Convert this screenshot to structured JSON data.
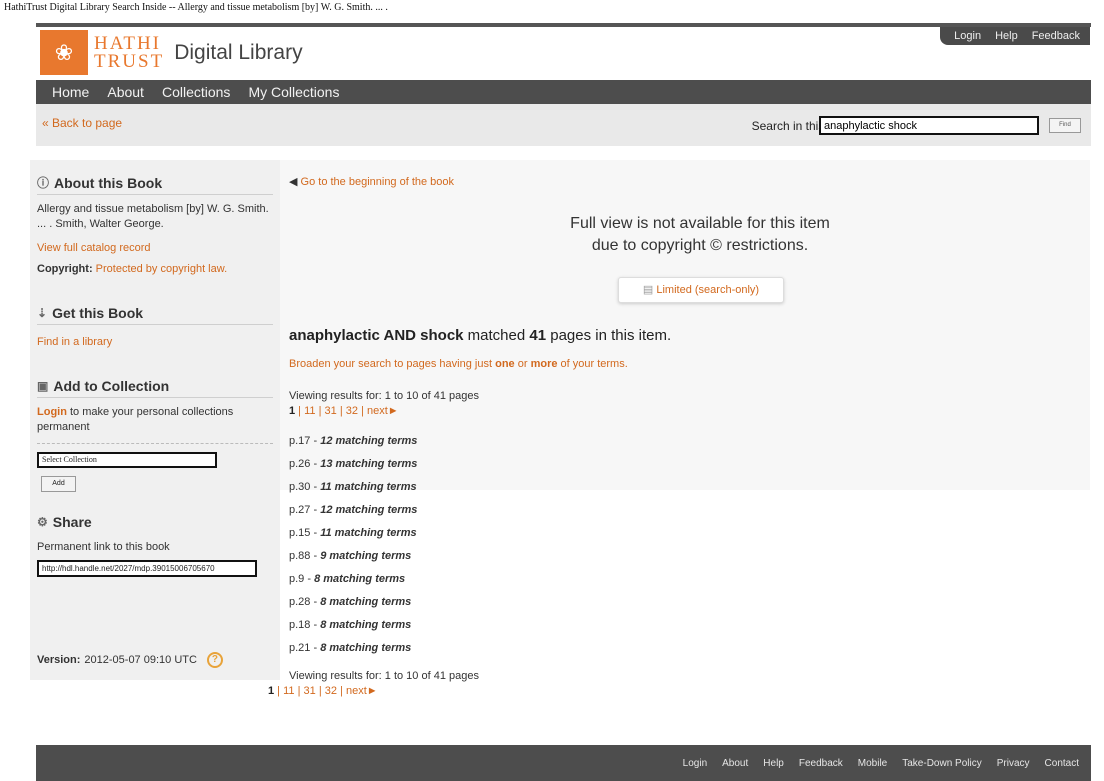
{
  "document_title": "HathiTrust Digital Library Search Inside -- Allergy and tissue metabolism [by] W. G. Smith. ... .",
  "util_nav": [
    "Login",
    "Help",
    "Feedback"
  ],
  "logo": {
    "line1": "HATHI",
    "line2": "TRUST",
    "tagline": "Digital Library"
  },
  "main_nav": [
    "Home",
    "About",
    "Collections",
    "My Collections"
  ],
  "subbar": {
    "back_label": "« Back to page",
    "search_label": "Search in this text",
    "search_value": "anaphylactic shock",
    "find_label": "Find"
  },
  "sidebar": {
    "about_heading": "About this Book",
    "book_title": "Allergy and tissue metabolism [by] W. G. Smith. ... . Smith, Walter George.",
    "catalog_link": "View full catalog record",
    "copyright_label": "Copyright:",
    "copyright_value": "Protected by copyright law.",
    "get_heading": "Get this Book",
    "find_library": "Find in a library",
    "add_heading": "Add to Collection",
    "login_link": "Login",
    "login_text": "to make your personal collections permanent",
    "select_value": "Select Collection",
    "add_button": "Add",
    "share_heading": "Share",
    "permalink_label": "Permanent link to this book",
    "permalink_value": "http://hdl.handle.net/2027/mdp.39015006705670",
    "version_label": "Version:",
    "version_value": "2012-05-07 09:10 UTC"
  },
  "content": {
    "goto_beginning": "Go to the beginning of the book",
    "notice_line1": "Full view is not available for this item",
    "notice_line2": "due to copyright © restrictions.",
    "limited_label": "Limited (search-only)",
    "query": "anaphylactic AND shock",
    "matched_text": "matched",
    "match_count": "41",
    "matched_suffix": "pages in this item.",
    "broaden_1": "Broaden your search to pages having just",
    "broaden_one": "one",
    "broaden_2": "or",
    "broaden_more": "more",
    "broaden_3": "of your terms.",
    "viewing": "Viewing results for: 1 to 10 of 41 pages",
    "pager": {
      "current": "1",
      "pages": [
        "11",
        "31",
        "32"
      ],
      "next": "next►"
    },
    "results": [
      {
        "page": "p.17",
        "terms": "12 matching terms"
      },
      {
        "page": "p.26",
        "terms": "13 matching terms"
      },
      {
        "page": "p.30",
        "terms": "11 matching terms"
      },
      {
        "page": "p.27",
        "terms": "12 matching terms"
      },
      {
        "page": "p.15",
        "terms": "11 matching terms"
      },
      {
        "page": "p.88",
        "terms": "9 matching terms"
      },
      {
        "page": "p.9",
        "terms": "8 matching terms"
      },
      {
        "page": "p.28",
        "terms": "8 matching terms"
      },
      {
        "page": "p.18",
        "terms": "8 matching terms"
      },
      {
        "page": "p.21",
        "terms": "8 matching terms"
      }
    ]
  },
  "footer": [
    "Login",
    "About",
    "Help",
    "Feedback",
    "Mobile",
    "Take-Down Policy",
    "Privacy",
    "Contact"
  ]
}
